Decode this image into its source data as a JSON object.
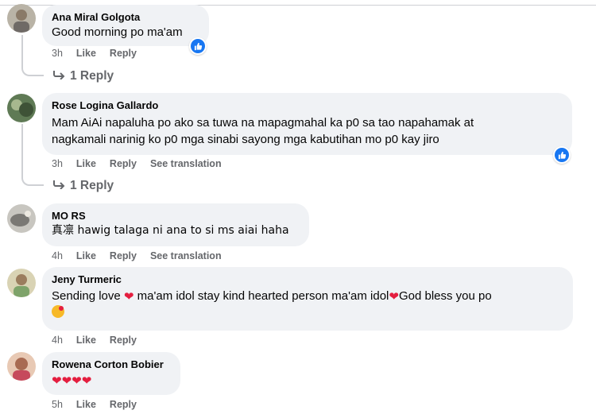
{
  "colors": {
    "bubble": "#f0f2f5",
    "meta": "#65676b",
    "like_blue": "#1877f2",
    "heart_red": "#e41e3f"
  },
  "comments": [
    {
      "author": "Ana Miral Golgota",
      "lines": [
        "Good morning po ma'am"
      ],
      "time": "3h",
      "like": "Like",
      "reply": "Reply",
      "reactions": [
        "like-icon"
      ],
      "replies_label": "1 Reply"
    },
    {
      "author": "Rose Logina Gallardo",
      "lines": [
        "Mam AiAi napaluha po ako sa tuwa na mapagmahal ka p0 sa tao napahamak at",
        "nagkamali narinig ko p0 mga sinabi sayong mga kabutihan mo p0 kay jiro"
      ],
      "time": "3h",
      "like": "Like",
      "reply": "Reply",
      "translate": "See translation",
      "reactions": [
        "like-icon"
      ],
      "replies_label": "1 Reply"
    },
    {
      "author": "MO RS",
      "lines": [
        "真凛 hawig talaga ni ana to si ms aiai haha"
      ],
      "time": "4h",
      "like": "Like",
      "reply": "Reply",
      "translate": "See translation"
    },
    {
      "author": "Jeny Turmeric",
      "line1_a": "Sending love ",
      "line1_b": " ma'am idol stay kind hearted person ma'am idol",
      "line1_c": "God bless you po",
      "heart_glyph": "❤",
      "kiss_icon": "face-blowing-kiss-icon",
      "time": "4h",
      "like": "Like",
      "reply": "Reply"
    },
    {
      "author": "Rowena Corton Bobier",
      "hearts": [
        "❤",
        "❤",
        "❤",
        "❤"
      ],
      "time": "5h",
      "like": "Like",
      "reply": "Reply"
    }
  ]
}
